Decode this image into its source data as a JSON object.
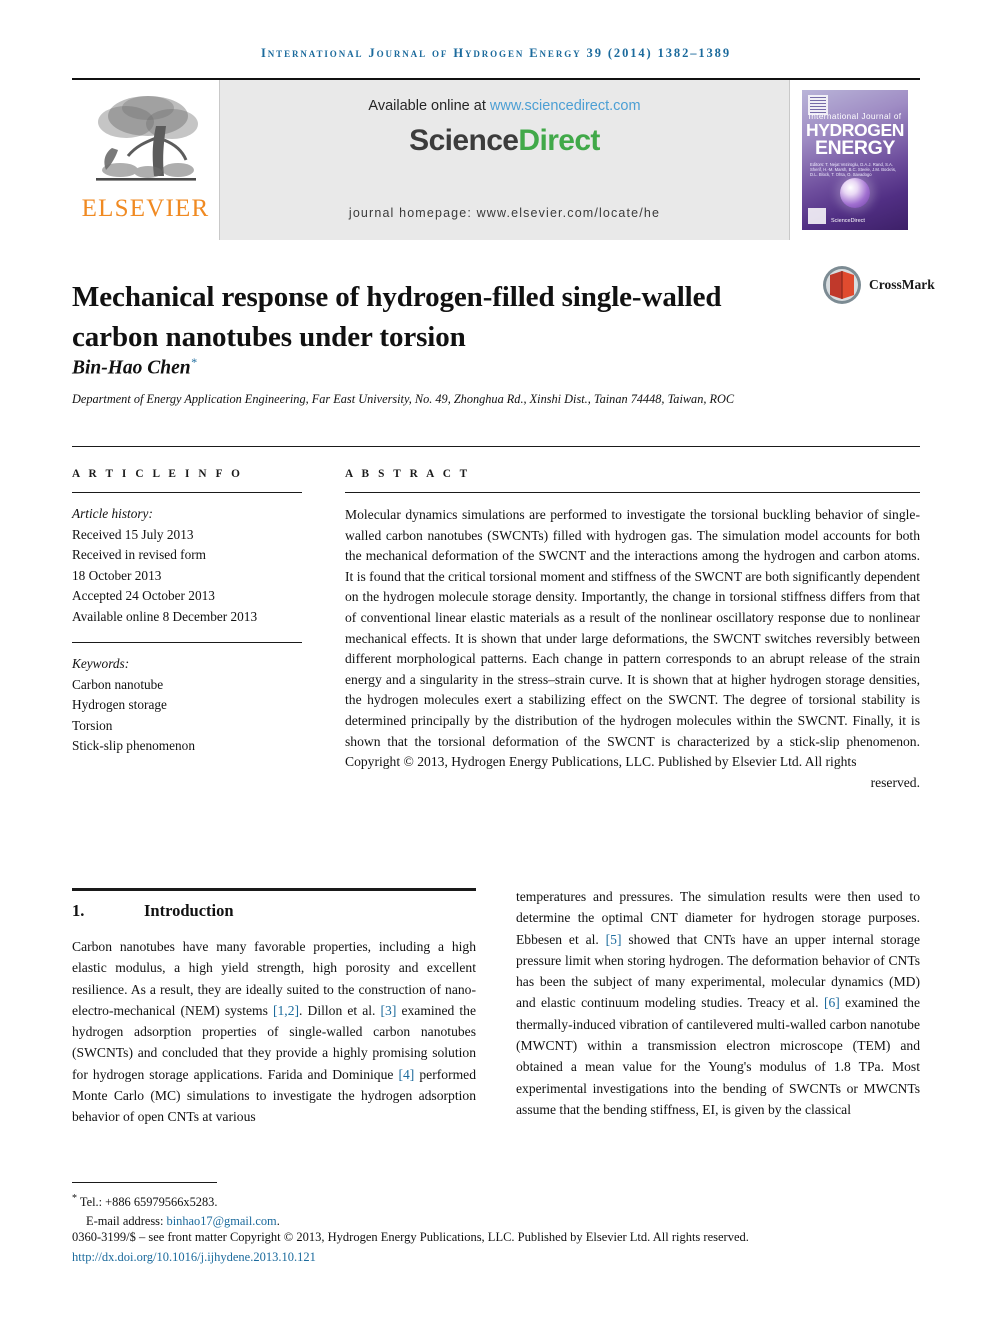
{
  "running_head": "International Journal of Hydrogen Energy 39 (2014) 1382–1389",
  "masthead": {
    "publisher_name": "ELSEVIER",
    "available_prefix": "Available online at ",
    "available_url": "www.sciencedirect.com",
    "sciencedirect_part1": "Science",
    "sciencedirect_part2": "Direct",
    "journal_homepage": "journal homepage: www.elsevier.com/locate/he",
    "cover": {
      "line1": "International Journal of",
      "line2": "HYDROGEN",
      "line3": "ENERGY",
      "editors": "Editors:  T. Nejat Veziroglu, D.A.J. Rand, S.A. Sherif, H.-M. Marsh,  B.C. Steele, J.M. Bockris, D.L. Block, T. Ohta, O. Savadogo",
      "sciencedirect_mark": "ScienceDirect"
    }
  },
  "colors": {
    "accent_blue": "#1b6a9c",
    "link_blue": "#4c9fd4",
    "elsevier_orange": "#f08a22",
    "sciencedirect_green": "#41a949",
    "banner_gray": "#e9e9e9"
  },
  "article": {
    "title": "Mechanical response of hydrogen-filled single-walled carbon nanotubes under torsion",
    "crossmark_label": "CrossMark",
    "author": "Bin-Hao Chen",
    "author_marker": "*",
    "affiliation": "Department of Energy Application Engineering, Far East University, No. 49, Zhonghua Rd., Xinshi Dist., Tainan 74448, Taiwan, ROC"
  },
  "article_info": {
    "label": "A R T I C L E   I N F O",
    "history_label": "Article history:",
    "history": [
      "Received 15 July 2013",
      "Received in revised form",
      "18 October 2013",
      "Accepted 24 October 2013",
      "Available online 8 December 2013"
    ],
    "keywords_label": "Keywords:",
    "keywords": [
      "Carbon nanotube",
      "Hydrogen storage",
      "Torsion",
      "Stick-slip phenomenon"
    ]
  },
  "abstract": {
    "label": "A B S T R A C T",
    "text": "Molecular dynamics simulations are performed to investigate the torsional buckling behavior of single-walled carbon nanotubes (SWCNTs) filled with hydrogen gas. The simulation model accounts for both the mechanical deformation of the SWCNT and the interactions among the hydrogen and carbon atoms. It is found that the critical torsional moment and stiffness of the SWCNT are both significantly dependent on the hydrogen molecule storage density. Importantly, the change in torsional stiffness differs from that of conventional linear elastic materials as a result of the nonlinear oscillatory response due to nonlinear mechanical effects. It is shown that under large deformations, the SWCNT switches reversibly between different morphological patterns. Each change in pattern corresponds to an abrupt release of the strain energy and a singularity in the stress–strain curve. It is shown that at higher hydrogen storage densities, the hydrogen molecules exert a stabilizing effect on the SWCNT. The degree of torsional stability is determined principally by the distribution of the hydrogen molecules within the SWCNT. Finally, it is shown that the torsional deformation of the SWCNT is characterized by a stick-slip phenomenon. Copyright © 2013, Hydrogen Energy Publications, LLC. Published by Elsevier Ltd. All rights",
    "text_tail": "reserved."
  },
  "introduction": {
    "number": "1.",
    "heading": "Introduction",
    "left_paragraph_a": "Carbon nanotubes have many favorable properties, including a high elastic modulus, a high yield strength, high porosity and excellent resilience. As a result, they are ideally suited to the construction of nano-electro-mechanical (NEM) systems ",
    "ref_1_2": "[1,2]",
    "left_paragraph_b": ". Dillon et al. ",
    "ref_3": "[3]",
    "left_paragraph_c": " examined the hydrogen adsorption properties of single-walled carbon nanotubes (SWCNTs) and concluded that they provide a highly promising solution for hydrogen storage applications. Farida and Dominique ",
    "ref_4": "[4]",
    "left_paragraph_d": " performed Monte Carlo (MC) simulations to investigate the hydrogen adsorption behavior of open CNTs at various",
    "right_paragraph_a": "temperatures and pressures. The simulation results were then used to determine the optimal CNT diameter for hydrogen storage purposes. Ebbesen et al. ",
    "ref_5": "[5]",
    "right_paragraph_b": " showed that CNTs have an upper internal storage pressure limit when storing hydrogen. The deformation behavior of CNTs has been the subject of many experimental, molecular dynamics (MD) and elastic continuum modeling studies. Treacy et al. ",
    "ref_6": "[6]",
    "right_paragraph_c": " examined the thermally-induced vibration of cantilevered multi-walled carbon nanotube (MWCNT) within a transmission electron microscope (TEM) and obtained a mean value for the Young's modulus of 1.8 TPa. Most experimental investigations into the bending of SWCNTs or MWCNTs assume that the bending stiffness, EI, is given by the classical"
  },
  "footnote": {
    "marker": "*",
    "tel": "Tel.: +886 65979566x5283.",
    "email_label": "E-mail address: ",
    "email": "binhao17@gmail.com",
    "email_period": "."
  },
  "footer": {
    "copyright": "0360-3199/$ – see front matter Copyright © 2013, Hydrogen Energy Publications, LLC. Published by Elsevier Ltd. All rights reserved.",
    "doi": "http://dx.doi.org/10.1016/j.ijhydene.2013.10.121"
  }
}
